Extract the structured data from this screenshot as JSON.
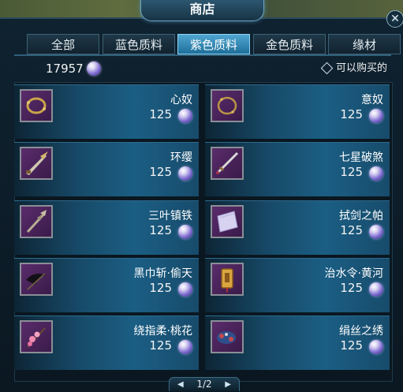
{
  "window": {
    "title": "商店",
    "close_symbol": "✕"
  },
  "tabs": [
    {
      "label": "全部",
      "active": false
    },
    {
      "label": "蓝色质料",
      "active": false
    },
    {
      "label": "紫色质料",
      "active": true
    },
    {
      "label": "金色质料",
      "active": false
    },
    {
      "label": "缘材",
      "active": false
    }
  ],
  "currency": {
    "amount": "17957",
    "icon": "purple-gem-icon"
  },
  "filter": {
    "label": "可以购买的",
    "checked": false
  },
  "items": [
    {
      "name": "心奴",
      "price": "125",
      "icon": "bracelet-icon"
    },
    {
      "name": "意奴",
      "price": "125",
      "icon": "bracelet-icon"
    },
    {
      "name": "环缨",
      "price": "125",
      "icon": "spear-head-icon"
    },
    {
      "name": "七星破煞",
      "price": "125",
      "icon": "sword-icon"
    },
    {
      "name": "三叶镇铁",
      "price": "125",
      "icon": "tri-blade-icon"
    },
    {
      "name": "拭剑之帕",
      "price": "125",
      "icon": "cloth-icon"
    },
    {
      "name": "黑巾斩·偷天",
      "price": "125",
      "icon": "black-scythe-icon"
    },
    {
      "name": "治水令·黄河",
      "price": "125",
      "icon": "golden-token-icon"
    },
    {
      "name": "绕指柔·桃花",
      "price": "125",
      "icon": "blossom-branch-icon"
    },
    {
      "name": "绢丝之绣",
      "price": "125",
      "icon": "embroidery-icon"
    }
  ],
  "pager": {
    "text": "1/2",
    "prev_symbol": "◀",
    "next_symbol": "▶"
  },
  "colors": {
    "active_tab": "#4fa6d0",
    "item_row": "#1b5e84",
    "icon_bg": "#5a2c6b"
  }
}
